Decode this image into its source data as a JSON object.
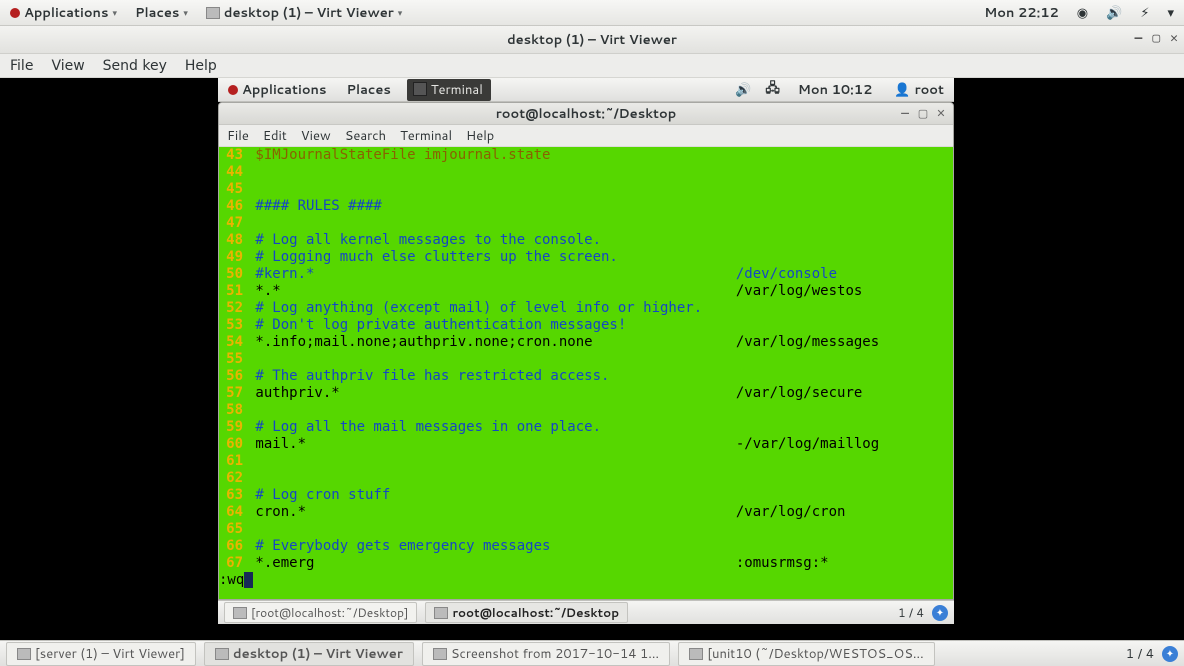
{
  "outer_panel": {
    "applications": "Applications",
    "places": "Places",
    "active_window": "desktop (1) – Virt Viewer",
    "clock": "Mon 22:12"
  },
  "virt": {
    "title": "desktop (1) – Virt Viewer",
    "menu": {
      "file": "File",
      "view": "View",
      "sendkey": "Send key",
      "help": "Help"
    }
  },
  "inner_panel": {
    "applications": "Applications",
    "places": "Places",
    "terminal_tab": "Terminal",
    "clock": "Mon 10:12",
    "user": "root"
  },
  "terminal": {
    "title": "root@localhost:~/Desktop",
    "menu": {
      "file": "File",
      "edit": "Edit",
      "view": "View",
      "search": "Search",
      "terminal": "Terminal",
      "help": "Help"
    },
    "lines": [
      {
        "n": "43",
        "body": "$IMJournalStateFile imjournal.state",
        "cls": "c-dir"
      },
      {
        "n": "44",
        "body": "",
        "cls": "c-text"
      },
      {
        "n": "45",
        "body": "",
        "cls": "c-text"
      },
      {
        "n": "46",
        "body": "#### RULES ####",
        "cls": "c-com"
      },
      {
        "n": "47",
        "body": "",
        "cls": "c-text"
      },
      {
        "n": "48",
        "body": "# Log all kernel messages to the console.",
        "cls": "c-com"
      },
      {
        "n": "49",
        "body": "# Logging much else clutters up the screen.",
        "cls": "c-com"
      },
      {
        "n": "50",
        "body": "#kern.*",
        "cls": "c-com",
        "right": "/dev/console",
        "rcls": "c-com"
      },
      {
        "n": "51",
        "body": "*.*",
        "cls": "c-text",
        "right": "/var/log/westos",
        "rcls": "c-text"
      },
      {
        "n": "52",
        "body": "# Log anything (except mail) of level info or higher.",
        "cls": "c-com"
      },
      {
        "n": "53",
        "body": "# Don't log private authentication messages!",
        "cls": "c-com"
      },
      {
        "n": "54",
        "body": "*.info;mail.none;authpriv.none;cron.none",
        "cls": "c-text",
        "right": "/var/log/messages",
        "rcls": "c-text"
      },
      {
        "n": "55",
        "body": "",
        "cls": "c-text"
      },
      {
        "n": "56",
        "body": "# The authpriv file has restricted access.",
        "cls": "c-com"
      },
      {
        "n": "57",
        "body": "authpriv.*",
        "cls": "c-text",
        "right": "/var/log/secure",
        "rcls": "c-text"
      },
      {
        "n": "58",
        "body": "",
        "cls": "c-text"
      },
      {
        "n": "59",
        "body": "# Log all the mail messages in one place.",
        "cls": "c-com"
      },
      {
        "n": "60",
        "body": "mail.*",
        "cls": "c-text",
        "right": "-/var/log/maillog",
        "rcls": "c-text"
      },
      {
        "n": "61",
        "body": "",
        "cls": "c-text"
      },
      {
        "n": "62",
        "body": "",
        "cls": "c-text"
      },
      {
        "n": "63",
        "body": "# Log cron stuff",
        "cls": "c-com"
      },
      {
        "n": "64",
        "body": "cron.*",
        "cls": "c-text",
        "right": "/var/log/cron",
        "rcls": "c-text"
      },
      {
        "n": "65",
        "body": "",
        "cls": "c-text"
      },
      {
        "n": "66",
        "body": "# Everybody gets emergency messages",
        "cls": "c-com"
      },
      {
        "n": "67",
        "body": "*.emerg",
        "cls": "c-text",
        "right": ":omusrmsg:*",
        "rcls": "c-text"
      }
    ],
    "cmd": ":wq"
  },
  "inner_taskbar": {
    "item1": "[root@localhost:~/Desktop]",
    "item2": "root@localhost:~/Desktop",
    "workspace": "1 / 4"
  },
  "outer_taskbar": {
    "items": [
      "[server (1) – Virt Viewer]",
      "desktop (1) – Virt Viewer",
      "Screenshot from 2017-10-14 1…",
      "[unit10 (~/Desktop/WESTOS_OS…"
    ],
    "workspace": "1 / 4"
  }
}
